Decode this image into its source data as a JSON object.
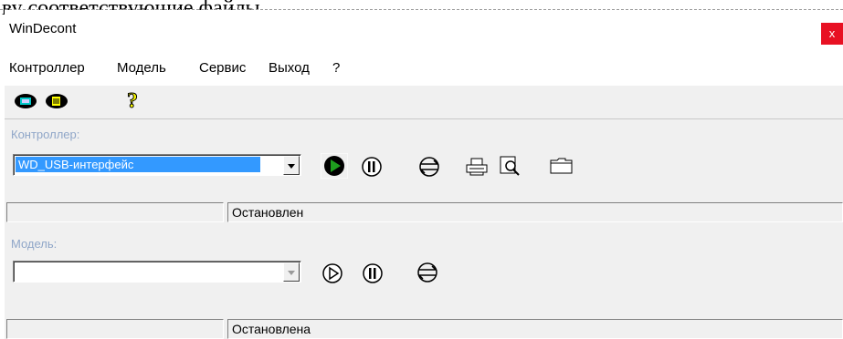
{
  "document_fragment": "      ву соответствующие файлы.",
  "window": {
    "title": "WinDecont",
    "close_glyph": "x"
  },
  "menu": [
    {
      "label": "Контроллер"
    },
    {
      "label": "Модель"
    },
    {
      "label": "Сервис"
    },
    {
      "label": "Выход"
    },
    {
      "label": "?"
    }
  ],
  "toolbar": {
    "icons": [
      "controller-window-icon",
      "model-window-icon",
      "help-icon"
    ]
  },
  "controller": {
    "label": "Контроллер:",
    "selected": "WD_USB-интерфейс",
    "status": "Остановлен",
    "buttons": [
      "run-icon",
      "pause-icon",
      "connect-icon",
      "print-icon",
      "preview-icon",
      "folder-icon"
    ]
  },
  "model": {
    "label": "Модель:",
    "selected": "",
    "status": "Остановлена",
    "buttons": [
      "play-icon",
      "pause-icon",
      "connect-icon"
    ]
  },
  "colors": {
    "accent_selection": "#3399ff",
    "close_button": "#e81123",
    "group_label": "#8fa6c8",
    "run_green": "#1e9e1e"
  }
}
